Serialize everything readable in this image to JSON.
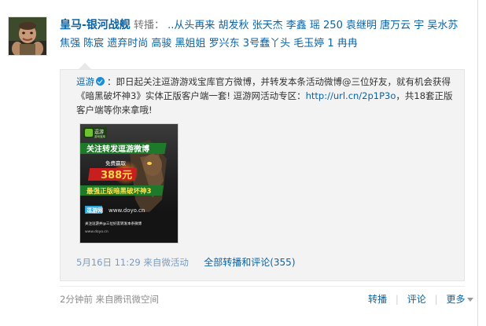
{
  "post": {
    "author": "皇马-银河战舰",
    "keywords_label": "转播：",
    "text": "..从头再来 胡发秋 张天杰 李鑫 瑶 250 袁继明 唐万云 宇 吴水苏 焦强 陈宸 遗弃时尚 高骏 黑姐姐 罗兴东 3号蠢丫头 毛玉婷 1 冉冉",
    "time": "2分钟前",
    "source": "来自腾讯微空间"
  },
  "quote": {
    "author": "逗游",
    "body_1": "：即日起关注逗游游戏宝库官方微博，并转发本条活动微博@三位好友，就有机会获得《暗黑破坏神3》实体正版客户端一套! 逗游网活动专区：",
    "link": "http://url.cn/2p1P3o",
    "body_2": "，共18套正版客户端等你来拿哦!",
    "date": "5月16日",
    "time": "11:29",
    "source": "来自微活动",
    "all_label": "全部转播和评论(355)"
  },
  "poster": {
    "logo": "逗游",
    "logo_sub": "游戏宝库",
    "headline": "关注转发逗游微博",
    "prize_label": "免费赢取",
    "price": "388元",
    "sub_headline": "最强正版暗黑破坏神3",
    "brand": "逗游网",
    "url": "www.doyo.cn",
    "footer": "关注逗游并@三位好友转发本条微博"
  },
  "actions": {
    "repost": "转播",
    "comment": "评论",
    "more": "更多"
  },
  "colors": {
    "link": "#0a63a5",
    "meta": "#8c8c8c",
    "quote_bg": "#f3f3f3"
  },
  "icons": {
    "verified": "verified-badge-icon",
    "more": "chevron-down-icon"
  }
}
